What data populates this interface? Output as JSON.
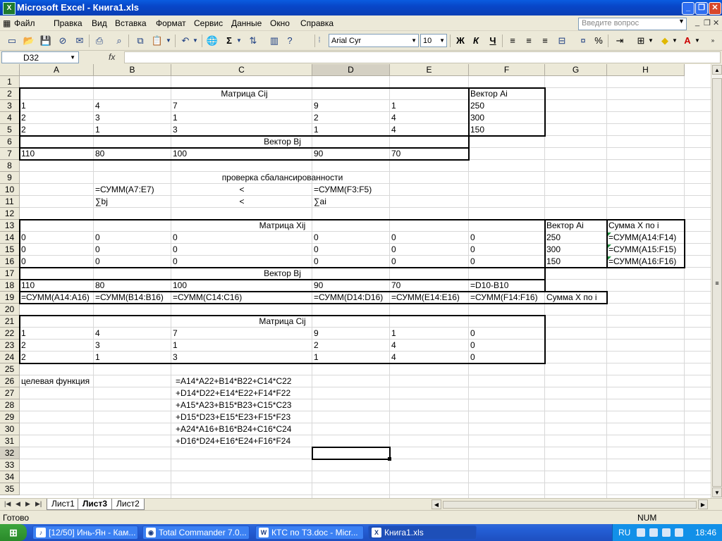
{
  "window": {
    "title": "Microsoft Excel - Книга1.xls",
    "app_icon_letter": "X"
  },
  "menu": {
    "items": [
      "Файл",
      "Правка",
      "Вид",
      "Вставка",
      "Формат",
      "Сервис",
      "Данные",
      "Окно",
      "Справка"
    ],
    "question_placeholder": "Введите вопрос"
  },
  "toolbar": {
    "font_name": "Arial Cyr",
    "font_size": "10",
    "bold": "Ж",
    "italic": "К",
    "underline": "Ч",
    "autosum": "Σ",
    "percent": "%"
  },
  "formula_bar": {
    "name_box": "D32",
    "fx": "fx",
    "content": ""
  },
  "columns": [
    "A",
    "B",
    "C",
    "D",
    "E",
    "F",
    "G",
    "H"
  ],
  "rows": [
    "1",
    "2",
    "3",
    "4",
    "5",
    "6",
    "7",
    "8",
    "9",
    "10",
    "11",
    "12",
    "13",
    "14",
    "15",
    "16",
    "17",
    "18",
    "19",
    "20",
    "21",
    "22",
    "23",
    "24",
    "25",
    "26",
    "27",
    "28",
    "29",
    "30",
    "31",
    "32",
    "33",
    "34",
    "35"
  ],
  "selected": {
    "col": "D",
    "row": "32"
  },
  "cells": {
    "r2": {
      "title": "Матрица Cij",
      "F": "Вектор Ai"
    },
    "r3": {
      "A": "1",
      "B": "4",
      "C": "7",
      "D": "9",
      "E": "1",
      "F": "250"
    },
    "r4": {
      "A": "2",
      "B": "3",
      "C": "1",
      "D": "2",
      "E": "4",
      "F": "300"
    },
    "r5": {
      "A": "2",
      "B": "1",
      "C": "3",
      "D": "1",
      "E": "4",
      "F": "150"
    },
    "r6": {
      "title": "Вектор Bj"
    },
    "r7": {
      "A": "110",
      "B": "80",
      "C": "100",
      "D": "90",
      "E": "70"
    },
    "r9": {
      "title": "проверка сбалансированности"
    },
    "r10": {
      "B": "=СУММ(A7:E7)",
      "C": "<",
      "D": "=СУММ(F3:F5)"
    },
    "r11": {
      "B": "∑bj",
      "C": "<",
      "D": "∑ai"
    },
    "r13": {
      "title": "Матрица Xij",
      "G": "Вектор Ai",
      "H": "Сумма Х по  i"
    },
    "r14": {
      "A": "0",
      "B": "0",
      "C": "0",
      "D": "0",
      "E": "0",
      "F": "0",
      "G": "250",
      "H": "=СУММ(A14:F14)"
    },
    "r15": {
      "A": "0",
      "B": "0",
      "C": "0",
      "D": "0",
      "E": "0",
      "F": "0",
      "G": "300",
      "H": "=СУММ(A15:F15)"
    },
    "r16": {
      "A": "0",
      "B": "0",
      "C": "0",
      "D": "0",
      "E": "0",
      "F": "0",
      "G": "150",
      "H": "=СУММ(A16:F16)"
    },
    "r17": {
      "title": "Вектор Bj"
    },
    "r18": {
      "A": "110",
      "B": "80",
      "C": "100",
      "D": "90",
      "E": "70",
      "F": "=D10-B10"
    },
    "r19": {
      "A": "=СУММ(A14:A16)",
      "B": "=СУММ(B14:B16)",
      "C": "=СУММ(C14:C16)",
      "D": "=СУММ(D14:D16)",
      "E": "=СУММ(E14:E16)",
      "F": "=СУММ(F14:F16)",
      "G": "Сумма Х по  i"
    },
    "r21": {
      "title": "Матрица Cij"
    },
    "r22": {
      "A": "1",
      "B": "4",
      "C": "7",
      "D": "9",
      "E": "1",
      "F": "0"
    },
    "r23": {
      "A": "2",
      "B": "3",
      "C": "1",
      "D": "2",
      "E": "4",
      "F": "0"
    },
    "r24": {
      "A": "2",
      "B": "1",
      "C": "3",
      "D": "1",
      "E": "4",
      "F": "0"
    },
    "r26": {
      "A": "целевая функция",
      "C": "=A14*A22+B14*B22+C14*C22"
    },
    "r27": {
      "C": "+D14*D22+E14*E22+F14*F22"
    },
    "r28": {
      "C": "+A15*A23+B15*B23+C15*C23"
    },
    "r29": {
      "C": "+D15*D23+E15*E23+F15*F23"
    },
    "r30": {
      "C": "+A24*A16+B16*B24+C16*C24"
    },
    "r31": {
      "C": "+D16*D24+E16*E24+F16*F24"
    }
  },
  "sheets": {
    "tabs": [
      "Лист1",
      "Лист3",
      "Лист2"
    ],
    "active": "Лист3"
  },
  "status": {
    "left": "Готово",
    "num": "NUM"
  },
  "taskbar": {
    "start": "⊞",
    "tasks": [
      "[12/50] Инь-Ян - Кам...",
      "Total Commander 7.0...",
      "КТС по ТЗ.doc - Micr...",
      "Книга1.xls"
    ],
    "lang": "RU",
    "clock": "18:46"
  },
  "colors": {
    "title_blue": "#0846c8",
    "taskbar_blue": "#245fd6",
    "start_green": "#2a8a2a",
    "comment_green": "#1e8e3e"
  }
}
